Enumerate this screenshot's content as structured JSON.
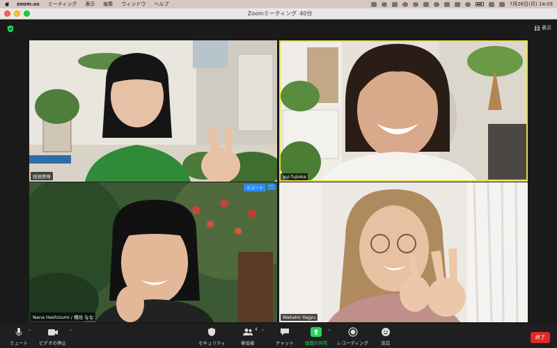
{
  "menubar": {
    "items": [
      "zoom.us",
      "ミーティング",
      "表示",
      "編集",
      "ウィンドウ",
      "ヘルプ"
    ],
    "clock": "7月26日(月)  14:03"
  },
  "window": {
    "title": "Zoomミーティング",
    "elapsed": "40分"
  },
  "topbar": {
    "view_label": "表示"
  },
  "participants": [
    {
      "name": "田淵美咲"
    },
    {
      "name": "yui fujioka"
    },
    {
      "name": "Nana Hashizumi / 橋住 なな"
    },
    {
      "name": "Wakaho Yagyu"
    }
  ],
  "tile_controls": {
    "mute_label": "ミュート",
    "more_label": "···"
  },
  "toolbar": {
    "mute": "ミュート",
    "stop_video": "ビデオの停止",
    "security": "セキュリティ",
    "participants": "参加者",
    "participant_count": "4",
    "chat": "チャット",
    "share": "画面の共有",
    "record": "レコーディング",
    "reactions": "反応",
    "end": "終了"
  },
  "colors": {
    "active_speaker": "#e8e03a",
    "share_green": "#23d959",
    "end_red": "#e02828",
    "zoom_blue": "#2d8cff"
  }
}
